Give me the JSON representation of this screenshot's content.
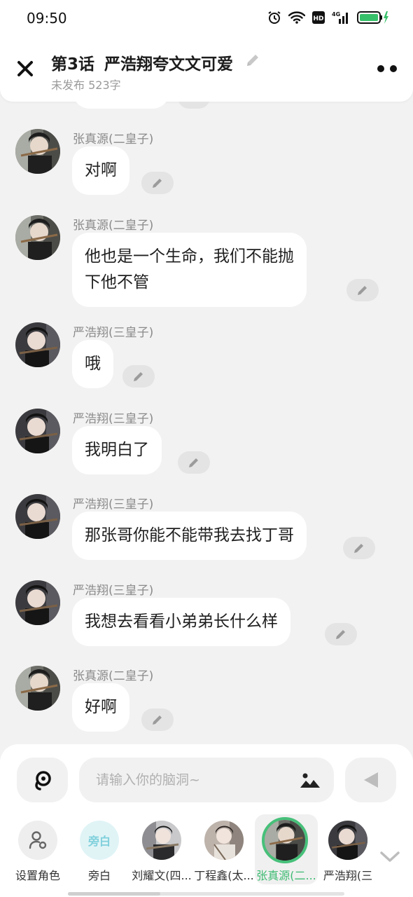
{
  "status_bar": {
    "time": "09:50",
    "network_label": "4G",
    "hd_label": "HD"
  },
  "header": {
    "episode": "第3话",
    "title": "严浩翔夸文文可爱",
    "subtitle": "未发布 523字"
  },
  "messages": [
    {
      "sender": "张真源(二皇子)",
      "lines": [
        "对啊"
      ]
    },
    {
      "sender": "张真源(二皇子)",
      "lines": [
        "他也是一个生命，我们不能抛",
        "下他不管"
      ]
    },
    {
      "sender": "严浩翔(三皇子)",
      "lines": [
        "哦"
      ]
    },
    {
      "sender": "严浩翔(三皇子)",
      "lines": [
        "我明白了"
      ]
    },
    {
      "sender": "严浩翔(三皇子)",
      "lines": [
        "那张哥你能不能带我去找丁哥"
      ]
    },
    {
      "sender": "严浩翔(三皇子)",
      "lines": [
        "我想去看看小弟弟长什么样"
      ]
    },
    {
      "sender": "张真源(二皇子)",
      "lines": [
        "好啊"
      ]
    }
  ],
  "input": {
    "placeholder": "请输入你的脑洞~"
  },
  "roles": [
    {
      "label": "设置角色",
      "icon": "person-settings-icon"
    },
    {
      "label": "旁白",
      "avatar_text": "旁白"
    },
    {
      "label": "刘耀文(四..."
    },
    {
      "label": "丁程鑫(太..."
    },
    {
      "label": "张真源(二...",
      "selected": true
    },
    {
      "label": "严浩翔(三"
    }
  ],
  "colors": {
    "accent": "#47c07a",
    "background": "#f2f2f2",
    "bubble": "#ffffff"
  }
}
